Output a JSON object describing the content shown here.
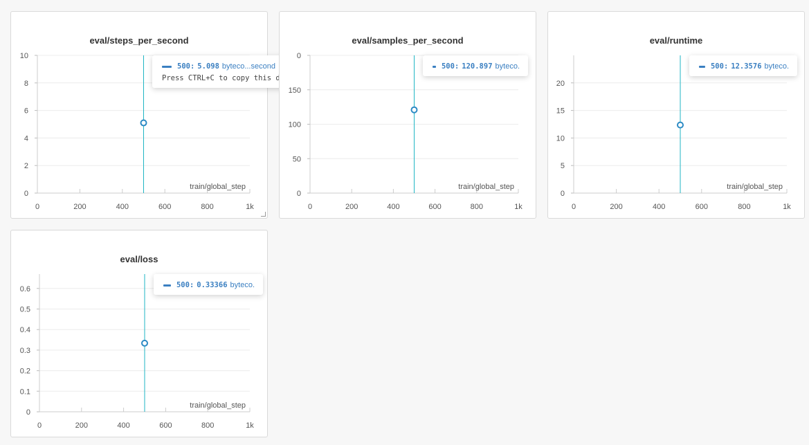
{
  "chart_data": [
    {
      "type": "scatter",
      "title": "eval/steps_per_second",
      "xlabel": "train/global_step",
      "ylabel": "",
      "xlim": [
        0,
        1000
      ],
      "ylim": [
        0,
        10
      ],
      "x_ticks": [
        "0",
        "200",
        "400",
        "600",
        "800",
        "1k"
      ],
      "y_ticks": [
        "0",
        "2",
        "4",
        "6",
        "8",
        "10"
      ],
      "series": [
        {
          "x": [
            500
          ],
          "y": [
            5.098
          ]
        }
      ],
      "tooltip": {
        "step": "500",
        "value": "5.098",
        "run": "byteco...second",
        "hint": "Press CTRL+C to copy this data"
      }
    },
    {
      "type": "scatter",
      "title": "eval/samples_per_second",
      "xlabel": "train/global_step",
      "ylabel": "",
      "xlim": [
        0,
        1000
      ],
      "ylim": [
        0,
        200
      ],
      "x_ticks": [
        "0",
        "200",
        "400",
        "600",
        "800",
        "1k"
      ],
      "y_ticks": [
        "0",
        "50",
        "100",
        "150",
        "0"
      ],
      "series": [
        {
          "x": [
            500
          ],
          "y": [
            120.897
          ]
        }
      ],
      "tooltip": {
        "step": "500",
        "value": "120.897",
        "run": "byteco.",
        "hint": ""
      }
    },
    {
      "type": "scatter",
      "title": "eval/runtime",
      "xlabel": "train/global_step",
      "ylabel": "",
      "xlim": [
        0,
        1000
      ],
      "ylim": [
        0,
        25
      ],
      "x_ticks": [
        "0",
        "200",
        "400",
        "600",
        "800",
        "1k"
      ],
      "y_ticks": [
        "0",
        "5",
        "10",
        "15",
        "20"
      ],
      "series": [
        {
          "x": [
            500
          ],
          "y": [
            12.3576
          ]
        }
      ],
      "tooltip": {
        "step": "500",
        "value": "12.3576",
        "run": "byteco.",
        "hint": ""
      }
    },
    {
      "type": "scatter",
      "title": "eval/loss",
      "xlabel": "train/global_step",
      "ylabel": "",
      "xlim": [
        0,
        1000
      ],
      "ylim": [
        0,
        0.67
      ],
      "x_ticks": [
        "0",
        "200",
        "400",
        "600",
        "800",
        "1k"
      ],
      "y_ticks": [
        "0",
        "0.1",
        "0.2",
        "0.3",
        "0.4",
        "0.5",
        "0.6"
      ],
      "series": [
        {
          "x": [
            500
          ],
          "y": [
            0.33366
          ]
        }
      ],
      "tooltip": {
        "step": "500",
        "value": "0.33366",
        "run": "byteco.",
        "hint": ""
      }
    }
  ],
  "colors": {
    "line": "#1fb5c4",
    "point": "#2b8ac4",
    "tooltip_text": "#3a7fc1",
    "grid": "#ececec"
  }
}
